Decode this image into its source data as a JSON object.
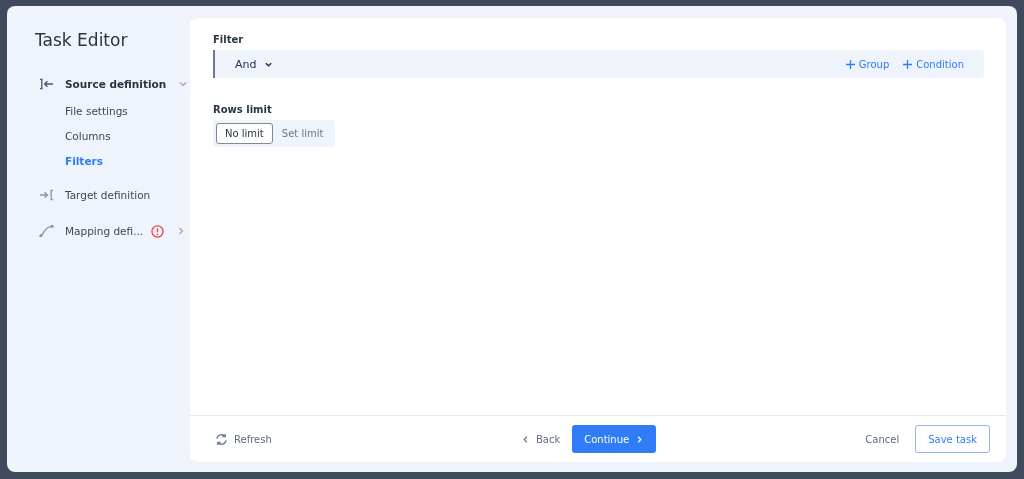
{
  "sidebar": {
    "title": "Task Editor",
    "sections": [
      {
        "kind": "source",
        "label": "Source definition",
        "expanded": true,
        "warning": false,
        "children": [
          {
            "label": "File settings",
            "selected": false
          },
          {
            "label": "Columns",
            "selected": false
          },
          {
            "label": "Filters",
            "selected": true
          }
        ]
      },
      {
        "kind": "target",
        "label": "Target definition",
        "warning": false
      },
      {
        "kind": "mapping",
        "label": "Mapping defi...",
        "expanded": false,
        "warning": true
      }
    ]
  },
  "filter": {
    "label": "Filter",
    "operator": "And",
    "actions": [
      "Group",
      "Condition"
    ]
  },
  "rows_limit": {
    "label": "Rows limit",
    "options": [
      {
        "label": "No limit",
        "selected": true
      },
      {
        "label": "Set limit",
        "selected": false
      }
    ]
  },
  "footer": {
    "refresh": "Refresh",
    "back": "Back",
    "continue": "Continue",
    "cancel": "Cancel",
    "save": "Save task"
  }
}
